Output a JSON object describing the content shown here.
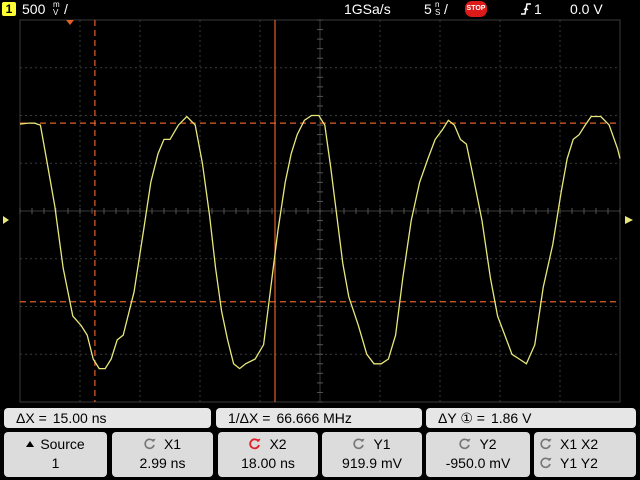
{
  "status_bar": {
    "channel_number": "1",
    "vertical_scale_value": "500",
    "vertical_scale_unit_top": "m",
    "vertical_scale_unit_bottom": "V",
    "vertical_scale_slash": "/",
    "sample_rate": "1GSa/s",
    "timebase_value": "5",
    "timebase_unit_top": "n",
    "timebase_unit_bottom": "S",
    "timebase_slash": "/",
    "run_state": "STOP",
    "trigger_source": "1",
    "trigger_level": "0.0 V",
    "icons": [
      "channel-badge",
      "stop-badge",
      "trigger-edge-icon"
    ]
  },
  "measurements": {
    "delta_x": {
      "label": "ΔX =",
      "value": "15.00 ns"
    },
    "inverse_delta_x": {
      "label": "1/ΔX =",
      "value": "66.666 MHz"
    },
    "delta_y": {
      "label": "ΔY ① =",
      "value": "1.86  V"
    }
  },
  "softkeys": {
    "source": {
      "label": "Source",
      "value": "1"
    },
    "x1": {
      "label": "X1",
      "value": "2.99 ns"
    },
    "x2": {
      "label": "X2",
      "value": "18.00 ns",
      "selected": true
    },
    "y1": {
      "label": "Y1",
      "value": "919.9 mV"
    },
    "y2": {
      "label": "Y2",
      "value": "-950.0 mV"
    },
    "x1x2": {
      "label": "X1  X2"
    },
    "y1y2": {
      "label": "Y1  Y2"
    }
  },
  "colors": {
    "trace": "#e8e87a",
    "cursor": "#e0602a",
    "channel": "#ffff33",
    "grid": "#3a3a3a",
    "stop": "#dd1a1a",
    "softkey_bg": "#dcdcdc"
  },
  "chart_data": {
    "type": "line",
    "xlabel": "",
    "ylabel": "",
    "x_unit": "ns",
    "y_unit": "V",
    "x_per_div": 5,
    "y_per_div": 0.5,
    "xlim": [
      -25,
      25
    ],
    "ylim": [
      -2,
      2
    ],
    "grid": true,
    "cursors": {
      "x1_ns": 2.99,
      "x2_ns": 18.0,
      "y1_v": 0.9199,
      "y2_v": -0.95
    },
    "series": [
      {
        "x": [
          -25.0,
          -24.3,
          -23.8,
          -23.3,
          -22.8,
          -22.1,
          -21.4,
          -20.6,
          -19.9,
          -19.4,
          -18.9,
          -18.4,
          -17.9,
          -17.4,
          -16.9,
          -16.4,
          -15.5,
          -14.7,
          -14.1,
          -13.5,
          -13.0,
          -12.5,
          -11.8,
          -11.1,
          -10.4,
          -9.8,
          -9.2,
          -8.7,
          -8.2,
          -7.7,
          -7.2,
          -6.7,
          -6.2,
          -5.4,
          -4.7,
          -4.1,
          -3.5,
          -2.9,
          -2.4,
          -1.9,
          -1.3,
          -0.7,
          -0.1,
          0.4,
          0.9,
          1.4,
          1.9,
          2.4,
          3.2,
          3.9,
          4.5,
          5.1,
          5.7,
          6.3,
          6.9,
          7.6,
          8.3,
          9.0,
          9.6,
          10.2,
          10.7,
          11.2,
          11.7,
          12.2,
          12.7,
          13.5,
          14.2,
          14.8,
          15.4,
          16.0,
          16.6,
          17.2,
          17.9,
          18.6,
          19.4,
          20.1,
          20.6,
          21.1,
          21.6,
          22.1,
          22.6,
          23.4,
          24.1,
          24.8,
          25.0
        ],
        "y": [
          0.91,
          0.92,
          0.92,
          0.9,
          0.55,
          0.05,
          -0.6,
          -1.1,
          -1.2,
          -1.3,
          -1.55,
          -1.65,
          -1.65,
          -1.55,
          -1.35,
          -1.3,
          -0.85,
          -0.2,
          0.3,
          0.6,
          0.75,
          0.75,
          0.9,
          0.99,
          0.9,
          0.5,
          -0.05,
          -0.6,
          -1.05,
          -1.35,
          -1.6,
          -1.65,
          -1.6,
          -1.55,
          -1.4,
          -0.8,
          -0.2,
          0.3,
          0.6,
          0.8,
          0.95,
          1.0,
          1.0,
          0.9,
          0.45,
          -0.05,
          -0.55,
          -0.9,
          -1.2,
          -1.5,
          -1.6,
          -1.6,
          -1.55,
          -1.3,
          -0.7,
          -0.1,
          0.3,
          0.55,
          0.75,
          0.85,
          0.95,
          0.9,
          0.75,
          0.7,
          0.4,
          -0.1,
          -0.7,
          -1.1,
          -1.3,
          -1.5,
          -1.55,
          -1.6,
          -1.4,
          -0.8,
          -0.35,
          0.2,
          0.55,
          0.75,
          0.8,
          0.9,
          0.99,
          0.99,
          0.9,
          0.65,
          0.55
        ]
      }
    ]
  }
}
